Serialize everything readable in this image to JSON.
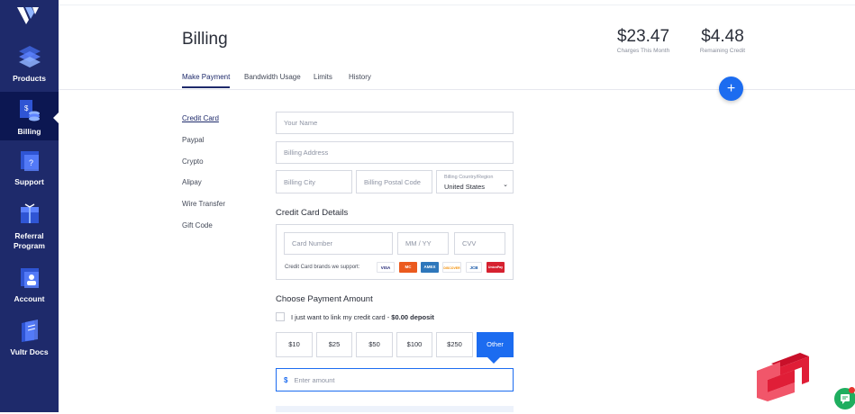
{
  "sidebar": {
    "items": [
      {
        "label": "Products",
        "icon": "products-icon"
      },
      {
        "label": "Billing",
        "icon": "billing-icon",
        "active": true
      },
      {
        "label": "Support",
        "icon": "support-icon"
      },
      {
        "label": "Referral Program",
        "label_line1": "Referral",
        "label_line2": "Program",
        "icon": "referral-icon"
      },
      {
        "label": "Account",
        "icon": "account-icon"
      },
      {
        "label": "Vultr Docs",
        "icon": "docs-icon"
      }
    ]
  },
  "header": {
    "title": "Billing",
    "charges": {
      "value": "$23.47",
      "label": "Charges This Month"
    },
    "credit": {
      "value": "$4.48",
      "label": "Remaining Credit"
    }
  },
  "tabs": [
    {
      "label": "Make Payment",
      "active": true
    },
    {
      "label": "Bandwidth Usage"
    },
    {
      "label": "Limits"
    },
    {
      "label": "History"
    }
  ],
  "fab": {
    "symbol": "+"
  },
  "payment_methods": [
    {
      "label": "Credit Card",
      "active": true
    },
    {
      "label": "Paypal"
    },
    {
      "label": "Crypto"
    },
    {
      "label": "Alipay"
    },
    {
      "label": "Wire Transfer"
    },
    {
      "label": "Gift Code"
    }
  ],
  "form": {
    "name_placeholder": "Your Name",
    "address_placeholder": "Billing Address",
    "city_placeholder": "Billing City",
    "postal_placeholder": "Billing Postal Code",
    "country_label": "Billing Country/Region",
    "country_value": "United States"
  },
  "card_details": {
    "title": "Credit Card Details",
    "number_placeholder": "Card Number",
    "expiry_placeholder": "MM / YY",
    "cvv_placeholder": "CVV",
    "brands_label": "Credit Card brands we support:",
    "brands": [
      "VISA",
      "MC",
      "AMEX",
      "DISCOVER",
      "JCB",
      "UnionPay"
    ]
  },
  "amount": {
    "title": "Choose Payment Amount",
    "link_text": "I just want to link my credit card - ",
    "link_bold": "$0.00 deposit",
    "options": [
      "$10",
      "$25",
      "$50",
      "$100",
      "$250",
      "Other"
    ],
    "selected": "Other",
    "currency_symbol": "$",
    "input_placeholder": "Enter amount"
  },
  "colors": {
    "sidebar": "#1e2a6b",
    "sidebar_active": "#0c1752",
    "accent": "#1c6cf0",
    "chat": "#1fae5f"
  }
}
